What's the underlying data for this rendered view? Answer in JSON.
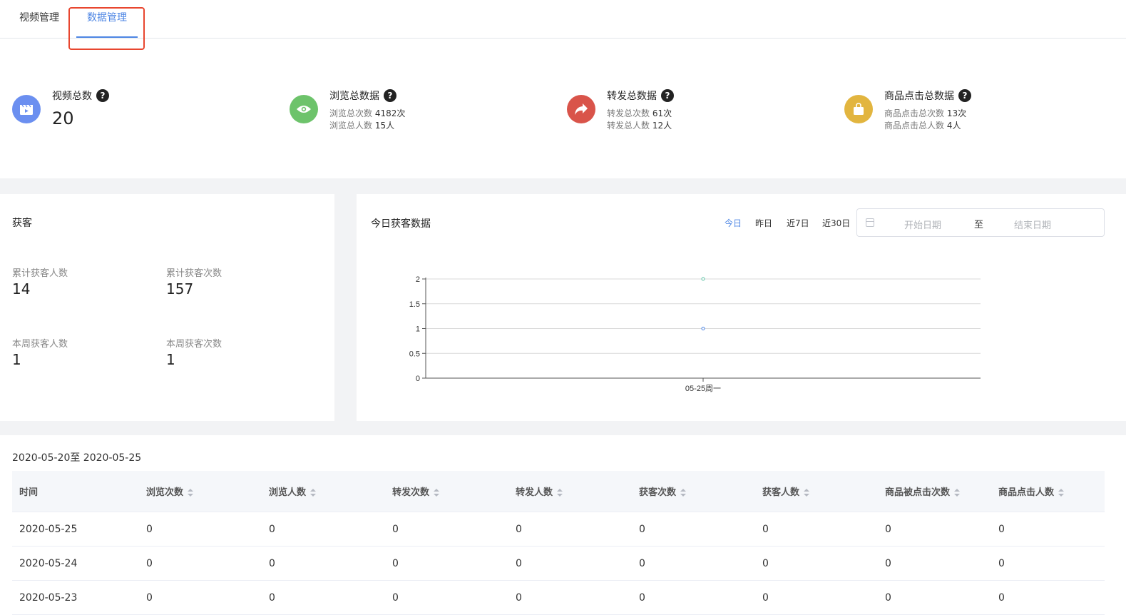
{
  "tabs": [
    {
      "label": "视频管理",
      "active": false
    },
    {
      "label": "数据管理",
      "active": true
    }
  ],
  "stats": {
    "videos": {
      "title": "视频总数",
      "value": "20",
      "icon": "video-icon",
      "color": "#6b8ff0"
    },
    "views": {
      "title": "浏览总数据",
      "icon": "eye-icon",
      "color": "#6dc36b",
      "line1_label": "浏览总次数",
      "line1_value": "4182次",
      "line2_label": "浏览总人数",
      "line2_value": "15人"
    },
    "shares": {
      "title": "转发总数据",
      "icon": "share-icon",
      "color": "#d9544a",
      "line1_label": "转发总次数",
      "line1_value": "61次",
      "line2_label": "转发总人数",
      "line2_value": "12人"
    },
    "clicks": {
      "title": "商品点击总数据",
      "icon": "bag-icon",
      "color": "#e2b53f",
      "line1_label": "商品点击总次数",
      "line1_value": "13次",
      "line2_label": "商品点击总人数",
      "line2_value": "4人"
    },
    "help": "?"
  },
  "acquire": {
    "title": "获客",
    "total_people_label": "累计获客人数",
    "total_people": "14",
    "total_times_label": "累计获客次数",
    "total_times": "157",
    "week_people_label": "本周获客人数",
    "week_people": "1",
    "week_times_label": "本周获客次数",
    "week_times": "1"
  },
  "today": {
    "title": "今日获客数据",
    "ranges": [
      "今日",
      "昨日",
      "近7日",
      "近30日"
    ],
    "active_range": "今日",
    "start_placeholder": "开始日期",
    "separator": "至",
    "end_placeholder": "结束日期"
  },
  "chart_data": {
    "type": "line",
    "categories": [
      "05-25周一"
    ],
    "series": [
      {
        "values": [
          2
        ],
        "color": "#5fc3a5"
      },
      {
        "values": [
          1
        ],
        "color": "#4e86e4"
      }
    ],
    "ylim": [
      0,
      2
    ],
    "yticks": [
      "0",
      "0.5",
      "1",
      "1.5",
      "2"
    ],
    "grid": true
  },
  "table": {
    "range_title": "2020-05-20至 2020-05-25",
    "columns": [
      "时间",
      "浏览次数",
      "浏览人数",
      "转发次数",
      "转发人数",
      "获客次数",
      "获客人数",
      "商品被点击次数",
      "商品点击人数"
    ],
    "rows": [
      [
        "2020-05-25",
        "0",
        "0",
        "0",
        "0",
        "0",
        "0",
        "0",
        "0"
      ],
      [
        "2020-05-24",
        "0",
        "0",
        "0",
        "0",
        "0",
        "0",
        "0",
        "0"
      ],
      [
        "2020-05-23",
        "0",
        "0",
        "0",
        "0",
        "0",
        "0",
        "0",
        "0"
      ]
    ]
  }
}
